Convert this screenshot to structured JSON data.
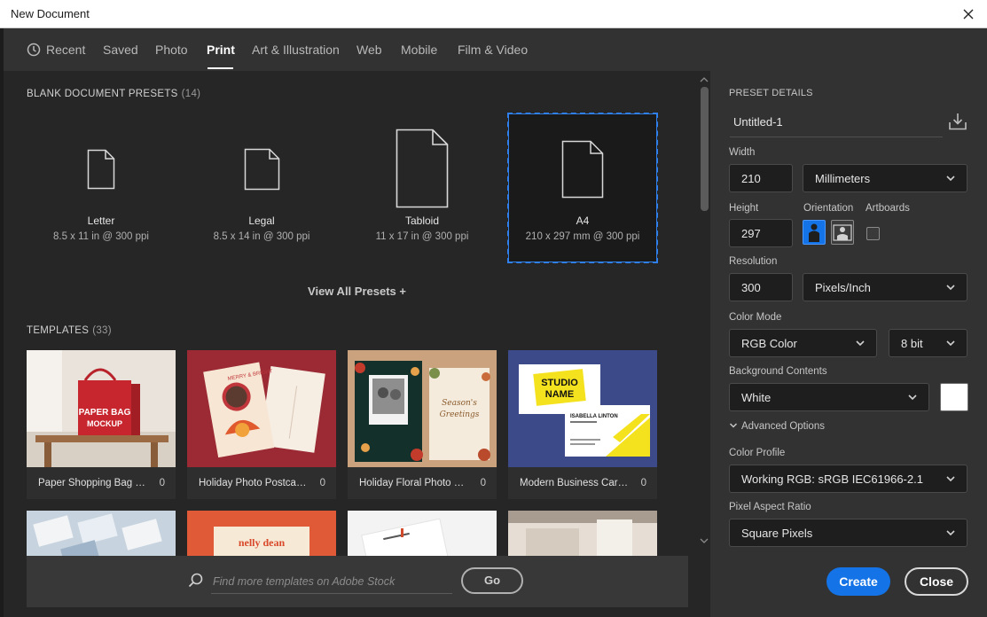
{
  "window": {
    "title": "New Document"
  },
  "tabs": [
    {
      "label": "Recent",
      "icon": "clock-icon"
    },
    {
      "label": "Saved"
    },
    {
      "label": "Photo"
    },
    {
      "label": "Print",
      "active": true
    },
    {
      "label": "Art & Illustration"
    },
    {
      "label": "Web"
    },
    {
      "label": "Mobile"
    },
    {
      "label": "Film & Video"
    }
  ],
  "presets": {
    "title": "BLANK DOCUMENT PRESETS",
    "count": "(14)",
    "items": [
      {
        "name": "Letter",
        "desc": "8.5 x 11 in @ 300 ppi"
      },
      {
        "name": "Legal",
        "desc": "8.5 x 14 in @ 300 ppi"
      },
      {
        "name": "Tabloid",
        "desc": "11 x 17 in @ 300 ppi"
      },
      {
        "name": "A4",
        "desc": "210 x 297 mm @ 300 ppi",
        "selected": true
      }
    ],
    "view_all": "View All Presets +"
  },
  "templates": {
    "title": "TEMPLATES",
    "count": "(33)",
    "items": [
      {
        "name": "Paper Shopping Bag Mo...",
        "count": "0",
        "art_text": "PAPER BAG MOCKUP"
      },
      {
        "name": "Holiday Photo Postcard...",
        "count": "0",
        "art_text": "MERRY & BRIGHT"
      },
      {
        "name": "Holiday Floral Photo Car...",
        "count": "0",
        "art_text": "Season's Greetings"
      },
      {
        "name": "Modern Business Card L...",
        "count": "0",
        "art_text_1": "STUDIO",
        "art_text_2": "NAME",
        "art_text_3": "ISABELLA LINTON"
      }
    ],
    "row2_texts": [
      "nelly dean"
    ]
  },
  "search": {
    "placeholder": "Find more templates on Adobe Stock",
    "go_label": "Go"
  },
  "details": {
    "section_title": "PRESET DETAILS",
    "doc_name": "Untitled-1",
    "width_label": "Width",
    "width_value": "210",
    "width_unit": "Millimeters",
    "height_label": "Height",
    "height_value": "297",
    "orientation_label": "Orientation",
    "artboards_label": "Artboards",
    "resolution_label": "Resolution",
    "resolution_value": "300",
    "resolution_unit": "Pixels/Inch",
    "color_mode_label": "Color Mode",
    "color_mode_value": "RGB Color",
    "bit_depth": "8 bit",
    "bg_label": "Background Contents",
    "bg_value": "White",
    "bg_swatch": "#ffffff",
    "advanced_label": "Advanced Options",
    "color_profile_label": "Color Profile",
    "color_profile_value": "Working RGB: sRGB IEC61966-2.1",
    "pixel_aspect_label": "Pixel Aspect Ratio",
    "pixel_aspect_value": "Square Pixels"
  },
  "actions": {
    "create": "Create",
    "close": "Close"
  },
  "colors": {
    "accent": "#1473e6",
    "selection": "#2f80ed",
    "panel": "#262626"
  }
}
